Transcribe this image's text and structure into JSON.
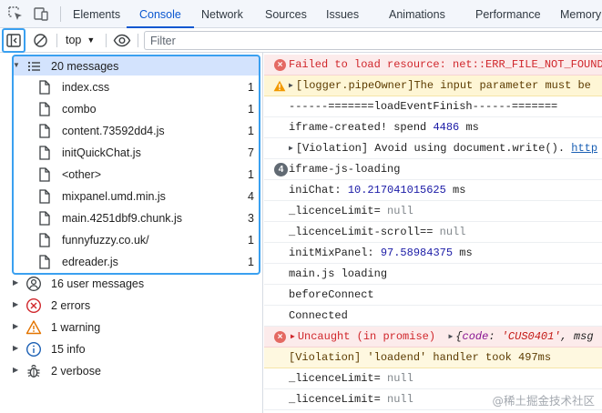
{
  "tabs": [
    {
      "label": "Elements",
      "active": false
    },
    {
      "label": "Console",
      "active": true
    },
    {
      "label": "Network",
      "active": false
    },
    {
      "label": "Sources",
      "active": false
    },
    {
      "label": "Issues",
      "active": false
    },
    {
      "label": "Animations",
      "active": false
    },
    {
      "label": "Performance",
      "active": false
    },
    {
      "label": "Memory",
      "active": false
    }
  ],
  "toolbar": {
    "context": "top",
    "filter_placeholder": "Filter"
  },
  "sidebar": {
    "messages_group": {
      "label": "20 messages",
      "icon": "list-icon"
    },
    "files": [
      {
        "name": "index.css",
        "count": "1"
      },
      {
        "name": "combo",
        "count": "1"
      },
      {
        "name": "content.73592dd4.js",
        "count": "1"
      },
      {
        "name": "initQuickChat.js",
        "count": "7"
      },
      {
        "name": "<other>",
        "count": "1"
      },
      {
        "name": "mixpanel.umd.min.js",
        "count": "4"
      },
      {
        "name": "main.4251dbf9.chunk.js",
        "count": "3"
      },
      {
        "name": "funnyfuzzy.co.uk/",
        "count": "1"
      },
      {
        "name": "edreader.js",
        "count": "1"
      }
    ],
    "groups": [
      {
        "label": "16 user messages",
        "icon": "user-icon"
      },
      {
        "label": "2 errors",
        "icon": "error-icon"
      },
      {
        "label": "1 warning",
        "icon": "warning-icon"
      },
      {
        "label": "15 info",
        "icon": "info-icon"
      },
      {
        "label": "2 verbose",
        "icon": "bug-icon"
      }
    ]
  },
  "console": {
    "l1": "Failed to load resource: net::ERR_FILE_NOT_FOUND",
    "l2": "[logger.pipeOwner]The input parameter must be",
    "l3": "------=======loadEventFinish------=======",
    "l4a": "iframe-created! spend ",
    "l4b": "4486",
    "l4c": " ms",
    "l5a": "[Violation] Avoid using document.write(). ",
    "l5b": "http",
    "l6_badge": "4",
    "l6": "iframe-js-loading",
    "l7a": "iniChat: ",
    "l7b": "10.217041015625",
    "l7c": " ms",
    "l8a": "_licenceLimit= ",
    "l8b": "null",
    "l9a": "_licenceLimit-scroll== ",
    "l9b": "null",
    "l10a": "initMixPanel: ",
    "l10b": "97.58984375",
    "l10c": " ms",
    "l11": "main.js loading",
    "l12": "beforeConnect",
    "l13": "Connected",
    "l14a": "Uncaught (in promise)",
    "l14b": "{",
    "l14c": "code",
    "l14d": ": ",
    "l14e": "'CUS0401'",
    "l14f": ", msg",
    "l15": "[Violation] 'loadend' handler took 497ms",
    "l16a": "_licenceLimit= ",
    "l16b": "null",
    "l17a": "_licenceLimit= ",
    "l17b": "null"
  },
  "watermark": "@稀土掘金技术社区",
  "colors": {
    "accent": "#0b57d0",
    "highlight": "#3aa0f0",
    "error": "#d0262b",
    "warning_bg": "#fef6d5"
  }
}
